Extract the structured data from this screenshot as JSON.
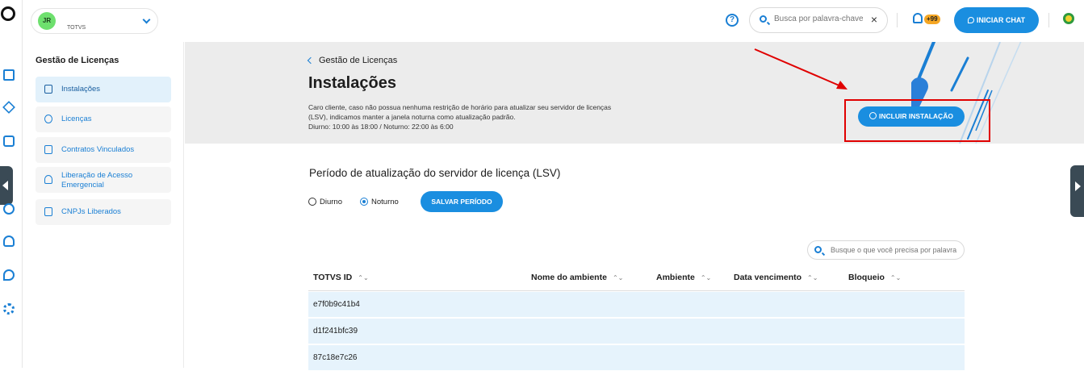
{
  "header": {
    "org_initials": "JR",
    "org_name": "TOTVS",
    "search_placeholder": "Busca por palavra-chave",
    "notification_count": "+99",
    "chat_button": "INICIAR CHAT"
  },
  "sidebar": {
    "title": "Gestão de Licenças",
    "items": [
      {
        "label": "Instalações"
      },
      {
        "label": "Licenças"
      },
      {
        "label": "Contratos Vinculados"
      },
      {
        "label": "Liberação de Acesso Emergencial"
      },
      {
        "label": "CNPJs Liberados"
      }
    ]
  },
  "hero": {
    "breadcrumb": "Gestão de Licenças",
    "title": "Instalações",
    "description": "Caro cliente, caso não possua nenhuma restrição de horário para atualizar seu servidor de licenças (LSV), indicamos manter a janela noturna como atualização padrão.",
    "schedule": "Diurno: 10:00 às 18:00 / Noturno: 22:00 às 6:00",
    "add_button": "INCLUIR INSTALAÇÃO"
  },
  "period": {
    "title": "Período de atualização do servidor de licença (LSV)",
    "option_day": "Diurno",
    "option_night": "Noturno",
    "selected": "Noturno",
    "save_button": "SALVAR PERÍODO"
  },
  "table": {
    "search_placeholder": "Busque o que você precisa por palavra",
    "columns": [
      "TOTVS ID",
      "Nome do ambiente",
      "Ambiente",
      "Data vencimento",
      "Bloqueio"
    ],
    "rows": [
      {
        "id": "e7f0b9c41b4"
      },
      {
        "id": "d1f241bfc39"
      },
      {
        "id": "87c18e7c26"
      }
    ]
  },
  "colors": {
    "accent": "#1a8ee0",
    "highlight": "#e00000",
    "row_bg": "#e6f3fc"
  }
}
